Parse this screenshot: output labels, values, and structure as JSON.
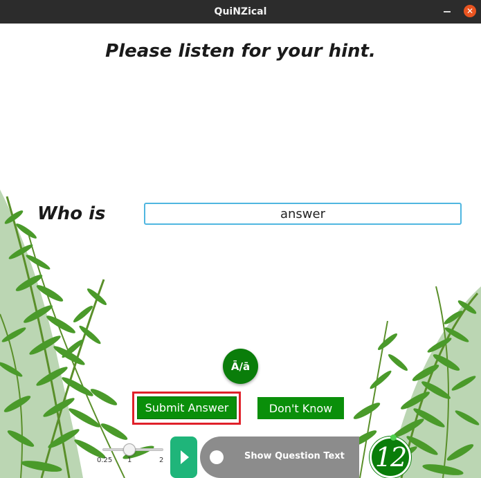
{
  "window": {
    "title": "QuiNZical",
    "minimize_label": "",
    "close_label": "✕"
  },
  "hint": {
    "text": "Please listen for your hint."
  },
  "answer": {
    "prefix": "Who is",
    "value": "answer"
  },
  "macron_button": {
    "label": "Ā/ā"
  },
  "actions": {
    "submit_label": "Submit Answer",
    "dont_know_label": "Don't Know"
  },
  "speed_slider": {
    "value": 1,
    "min": 0.25,
    "max": 2,
    "tick_labels": [
      "0.25",
      "1",
      "2"
    ]
  },
  "show_question_toggle": {
    "label": "Show Question Text",
    "checked": false
  },
  "timer": {
    "seconds": "12"
  },
  "colors": {
    "accent_green": "#0a8f0a",
    "play_green": "#1fb57a",
    "highlight_red": "#e0202a",
    "input_border": "#4fb6e0"
  }
}
